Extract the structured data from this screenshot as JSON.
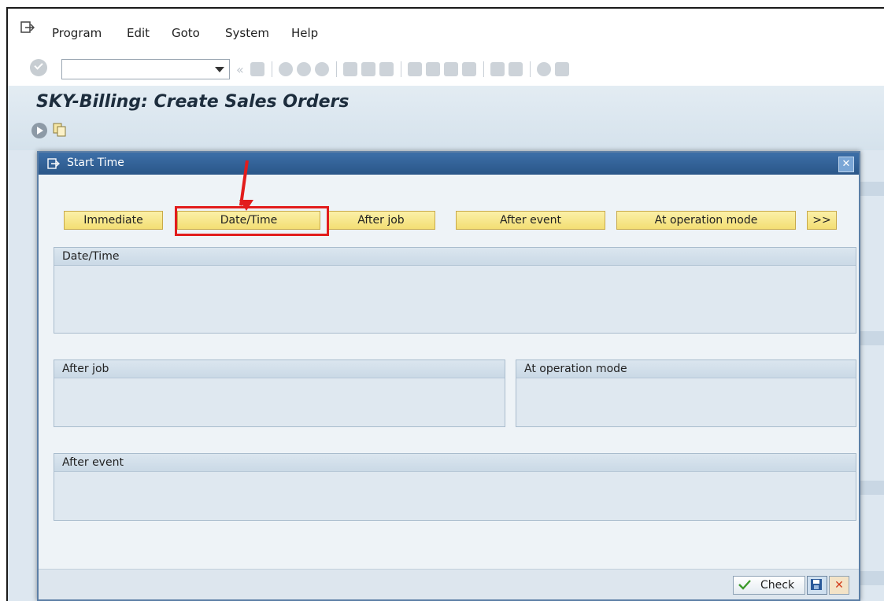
{
  "menu": {
    "items": [
      "Program",
      "Edit",
      "Goto",
      "System",
      "Help"
    ],
    "underline": [
      "P",
      "E",
      "G",
      "S",
      "H"
    ]
  },
  "toolbar": {
    "command_field_value": "",
    "icons": [
      "ok-icon",
      "back-icon",
      "save-icon",
      "back-nav-icon",
      "exit-nav-icon",
      "cancel-nav-icon",
      "print-icon",
      "find-icon",
      "find-next-icon",
      "first-page-icon",
      "prev-page-icon",
      "next-page-icon",
      "last-page-icon",
      "new-session-icon",
      "shortcut-icon",
      "help-icon",
      "layout-icon"
    ]
  },
  "title": "SKY-Billing: Create Sales Orders",
  "dialog": {
    "title": "Start Time",
    "buttons": {
      "immediate": "Immediate",
      "date_time": "Date/Time",
      "after_job": "After job",
      "after_event": "After event",
      "at_operation_mode": "At operation mode",
      "more": ">>"
    },
    "groups": {
      "date_time": "Date/Time",
      "after_job": "After job",
      "at_operation_mode": "At operation mode",
      "after_event": "After event"
    },
    "footer": {
      "check": "Check"
    }
  },
  "colors": {
    "highlight": "#e21c1c",
    "dialog_title": "#2a5688",
    "button_yellow": "#f3de73"
  }
}
